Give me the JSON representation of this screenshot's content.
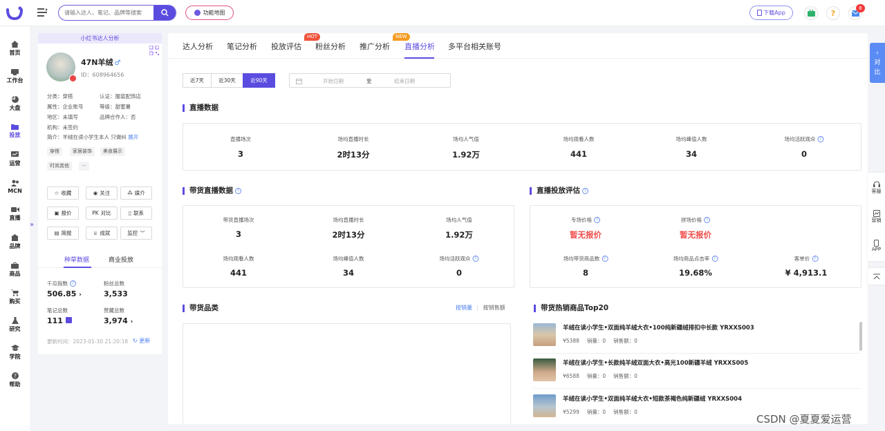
{
  "topbar": {
    "search_placeholder": "请输入达人、笔记、品牌等搜索",
    "func_map": "功能地图",
    "download_app": "下载App",
    "notification_count": "8"
  },
  "nav": [
    {
      "label": "首页",
      "icon": "home-icon"
    },
    {
      "label": "工作台",
      "icon": "workbench-icon"
    },
    {
      "label": "大盘",
      "icon": "pie-chart-icon"
    },
    {
      "label": "投放",
      "icon": "folder-icon",
      "active": true
    },
    {
      "label": "运营",
      "icon": "monitor-chart-icon"
    },
    {
      "label": "MCN",
      "icon": "people-icon"
    },
    {
      "label": "直播",
      "icon": "video-icon"
    },
    {
      "label": "品牌",
      "icon": "brand-icon"
    },
    {
      "label": "商品",
      "icon": "bag-icon"
    },
    {
      "label": "购买",
      "icon": "cart-icon"
    },
    {
      "label": "研究",
      "icon": "flask-icon"
    },
    {
      "label": "学院",
      "icon": "graduation-cap-icon"
    },
    {
      "label": "帮助",
      "icon": "help-icon"
    }
  ],
  "profile": {
    "panel_title": "小红书达人分析",
    "name": "47N羊绒",
    "gender": "♂",
    "id": "ID：608964656",
    "category": "分类：穿搭",
    "cert": "认证：服装配饰店",
    "attr": "属性：企业账号",
    "level": "等级：甜蜜薯",
    "region": "地区：未填写",
    "brand_partner": "品牌合作人：否",
    "org": "机构：未签约",
    "intro": "简介：羊绒在读小学生本人 只做纠",
    "expand": "展开",
    "tags": [
      "穿搭",
      "家居装饰",
      "美食展示",
      "时尚其他",
      "···"
    ],
    "buttons": [
      "收藏",
      "关注",
      "媒介",
      "报价",
      "对比",
      "联系",
      "简报",
      "成就",
      "监控"
    ],
    "tabs": [
      "种草数据",
      "商业投放"
    ],
    "stats": {
      "qiangua_label": "千瓜指数",
      "qiangua_value": "506.85",
      "fans_label": "粉丝总数",
      "fans_value": "3,533",
      "notes_label": "笔记总数",
      "notes_value": "111",
      "likes_label": "赞藏总数",
      "likes_value": "3,974"
    },
    "updated": "更新时间：2023-01-30 21:20:18",
    "update_btn": "更新"
  },
  "main": {
    "tabs": [
      "达人分析",
      "笔记分析",
      "投放评估",
      "粉丝分析",
      "推广分析",
      "直播分析",
      "多平台相关账号"
    ],
    "badge_hot": "HOT",
    "badge_new": "NEW",
    "ranges": [
      "近7天",
      "近30天",
      "近90天"
    ],
    "date_start": "开始日期",
    "date_sep": "至",
    "date_end": "结束日期",
    "live_data": {
      "title": "直播数据",
      "metrics": [
        {
          "label": "直播场次",
          "value": "3"
        },
        {
          "label": "场均直播时长",
          "value": "2时13分"
        },
        {
          "label": "场均人气值",
          "value": "1.92万"
        },
        {
          "label": "场均观看人数",
          "value": "441"
        },
        {
          "label": "场均峰值人数",
          "value": "34"
        },
        {
          "label": "场均活跃观众",
          "value": "0"
        }
      ]
    },
    "sales_live": {
      "title": "带货直播数据",
      "metrics": [
        {
          "label": "带货直播场次",
          "value": "3"
        },
        {
          "label": "场均直播时长",
          "value": "2时13分"
        },
        {
          "label": "场均人气值",
          "value": "1.92万"
        },
        {
          "label": "场均观看人数",
          "value": "441"
        },
        {
          "label": "场均峰值人数",
          "value": "34"
        },
        {
          "label": "场均活跃观众",
          "value": "0"
        }
      ]
    },
    "eval": {
      "title": "直播投放评估",
      "metrics": [
        {
          "label": "专场价格",
          "value": "暂无报价"
        },
        {
          "label": "拼场价格",
          "value": "暂无报价"
        },
        {
          "label": "场均带货商品数",
          "value": "8"
        },
        {
          "label": "场均商品点击率",
          "value": "19.68%"
        },
        {
          "label": "客单价",
          "value": "¥ 4,913.1"
        }
      ]
    },
    "category": {
      "title": "带货品类",
      "sort_by_qty": "按销量",
      "sort_by_amount": "按销售额"
    },
    "top20": {
      "title": "带货热销商品Top20",
      "items": [
        {
          "title": "羊绒在读小学生•双面纯羊绒大衣•100纯新疆绒排扣中长款 YRXXS003",
          "price": "¥5388",
          "qty": "销量：0",
          "amount": "销售额：0"
        },
        {
          "title": "羊绒在读小学生•长款纯羊绒双面大衣•高光100新疆羊绒 YRXXS005",
          "price": "¥6588",
          "qty": "销量：0",
          "amount": "销售额：0"
        },
        {
          "title": "羊绒在读小学生•双面纯羊绒大衣•短款茶褐色纯新疆绒 YRXXS004",
          "price": "¥5299",
          "qty": "销量：0",
          "amount": "销售额：0"
        }
      ]
    }
  },
  "side": {
    "contrast": [
      "对",
      "比"
    ],
    "tools": [
      "客服",
      "营销",
      "APP"
    ]
  },
  "watermark": "CSDN @夏夏爱运营",
  "colors": {
    "accent": "#5b4ce0",
    "hot": "#f0533a",
    "new": "#f59b22",
    "red_value": "#f04b4b"
  }
}
